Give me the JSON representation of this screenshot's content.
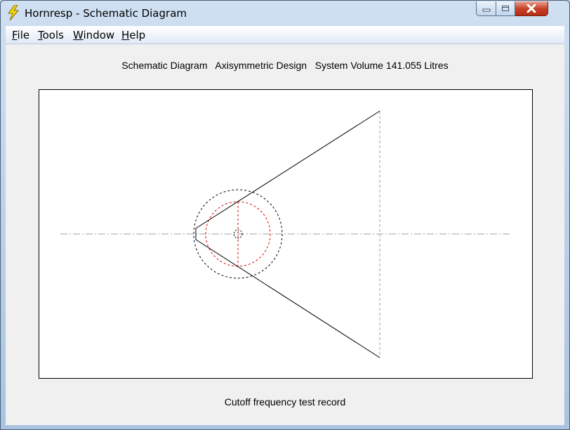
{
  "window": {
    "title": "Hornresp - Schematic Diagram",
    "controls": {
      "minimize": "minimize",
      "maximize": "maximize",
      "close": "close"
    }
  },
  "menu": [
    {
      "label": "File",
      "accel": "F",
      "rest": "ile"
    },
    {
      "label": "Tools",
      "accel": "T",
      "rest": "ools"
    },
    {
      "label": "Window",
      "accel": "W",
      "rest": "indow"
    },
    {
      "label": "Help",
      "accel": "H",
      "rest": "elp"
    }
  ],
  "header": {
    "text": "Schematic Diagram   Axisymmetric Design   System Volume 141.055 Litres"
  },
  "footer": {
    "text": "Cutoff frequency test record"
  },
  "colors": {
    "title_bar": "#bcd0e6",
    "canvas_bg": "#ffffff",
    "horn_line": "#000000",
    "red_dashed": "#e00000",
    "axis_line": "#a0a0a0"
  },
  "icons": {
    "app": "lightning-bolt-icon",
    "minimize": "minimize-icon",
    "maximize": "maximize-icon",
    "close": "close-icon"
  }
}
